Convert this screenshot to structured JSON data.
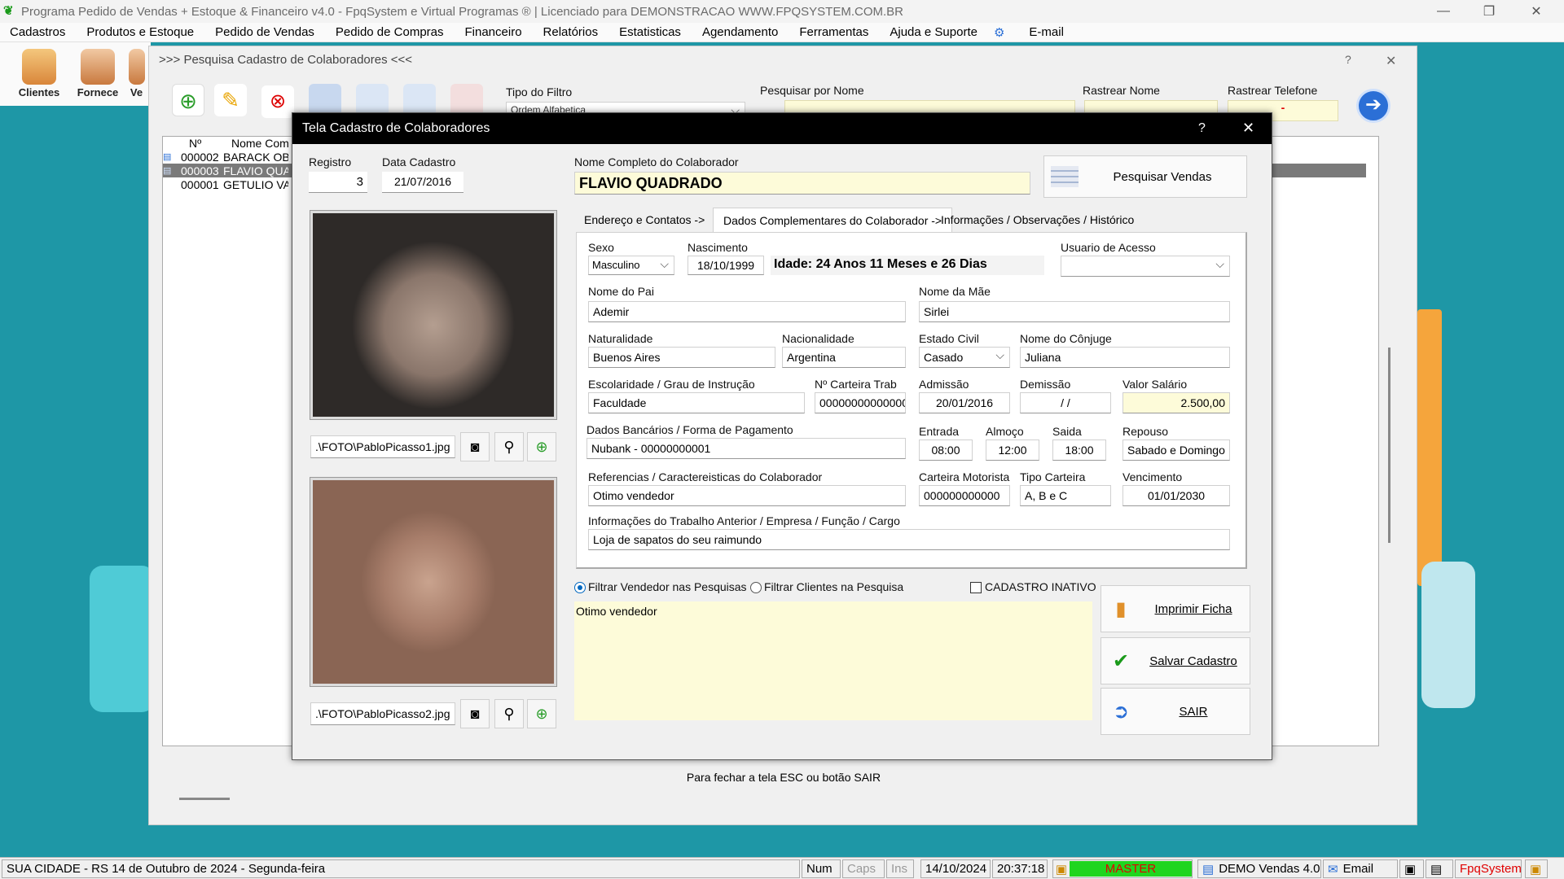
{
  "app": {
    "title": "Programa Pedido de Vendas + Estoque & Financeiro v4.0 - FpqSystem e Virtual Programas ® | Licenciado para  DEMONSTRACAO WWW.FPQSYSTEM.COM.BR"
  },
  "menu": {
    "items": [
      "Cadastros",
      "Produtos e Estoque",
      "Pedido de Vendas",
      "Pedido de Compras",
      "Financeiro",
      "Relatórios",
      "Estatisticas",
      "Agendamento",
      "Ferramentas",
      "Ajuda e Suporte",
      "E-mail"
    ]
  },
  "toolbar": {
    "clientes": "Clientes",
    "fornece": "Fornece",
    "ve": "Ve"
  },
  "search_window": {
    "title": ">>> Pesquisa Cadastro de Colaboradores <<<",
    "filter_type_label": "Tipo do Filtro",
    "filter_type_value": "Ordem Alfabetica",
    "search_name_label": "Pesquisar por Nome",
    "track_name_label": "Rastrear Nome",
    "track_phone_label": "Rastrear Telefone",
    "track_phone_value": "-",
    "columns": [
      "Nº",
      "Nome Comp"
    ],
    "rows": [
      {
        "num": "000002",
        "name": "BARACK OB"
      },
      {
        "num": "000003",
        "name": "FLAVIO QUA"
      },
      {
        "num": "000001",
        "name": "GETULIO VA"
      }
    ],
    "footer_hint": "Para fechar a tela ESC ou botão SAIR"
  },
  "dialog": {
    "title": "Tela Cadastro de Colaboradores",
    "help": "?",
    "registro_label": "Registro",
    "registro": "3",
    "data_cadastro_label": "Data Cadastro",
    "data_cadastro": "21/07/2016",
    "nome_label": "Nome Completo do Colaborador",
    "nome": "FLAVIO QUADRADO",
    "pesquisar_vendas": "Pesquisar Vendas",
    "foto1_path": ".\\FOTO\\PabloPicasso1.jpg",
    "foto2_path": ".\\FOTO\\PabloPicasso2.jpg",
    "tabs": [
      "Endereço e Contatos ->",
      "Dados Complementares do Colaborador ->",
      "Informações / Observações / Histórico"
    ],
    "sexo_label": "Sexo",
    "sexo": "Masculino",
    "nascimento_label": "Nascimento",
    "nascimento": "18/10/1999",
    "idade": "Idade: 24 Anos 11 Meses e 26 Dias",
    "usuario_label": "Usuario de Acesso",
    "usuario": "",
    "pai_label": "Nome do Pai",
    "pai": "Ademir",
    "mae_label": "Nome da Mãe",
    "mae": "Sirlei",
    "naturalidade_label": "Naturalidade",
    "naturalidade": "Buenos Aires",
    "nacionalidade_label": "Nacionalidade",
    "nacionalidade": "Argentina",
    "estado_civil_label": "Estado Civil",
    "estado_civil": "Casado",
    "conjuge_label": "Nome do Cônjuge",
    "conjuge": "Juliana",
    "escolaridade_label": "Escolaridade / Grau de Instrução",
    "escolaridade": "Faculdade",
    "carteira_trab_label": "Nº Carteira Trab",
    "carteira_trab": "00000000000000",
    "admissao_label": "Admissão",
    "admissao": "20/01/2016",
    "demissao_label": "Demissão",
    "demissao": "/ /",
    "salario_label": "Valor Salário",
    "salario": "2.500,00",
    "bancarios_label": "Dados Bancários / Forma de Pagamento",
    "bancarios": "Nubank - 00000000001",
    "entrada_label": "Entrada",
    "entrada": "08:00",
    "almoco_label": "Almoço",
    "almoco": "12:00",
    "saida_label": "Saida",
    "saida": "18:00",
    "repouso_label": "Repouso",
    "repouso": "Sabado e Domingo",
    "referencias_label": "Referencias / Caractereisticas do Colaborador",
    "referencias": "Otimo vendedor",
    "motorista_label": "Carteira Motorista",
    "motorista": "000000000000",
    "tipo_carteira_label": "Tipo Carteira",
    "tipo_carteira": "A, B e C",
    "vencimento_label": "Vencimento",
    "vencimento": "01/01/2030",
    "trabalho_anterior_label": "Informações do Trabalho Anterior / Empresa / Função / Cargo",
    "trabalho_anterior": "Loja de sapatos do seu raimundo",
    "radio_vendedor": "Filtrar Vendedor nas Pesquisas",
    "radio_clientes": "Filtrar Clientes na Pesquisa",
    "inativo": "CADASTRO INATIVO",
    "obs": "Otimo vendedor",
    "btn_imprimir": "Imprimir Ficha",
    "btn_salvar": "Salvar Cadastro",
    "btn_sair": "SAIR"
  },
  "statusbar": {
    "city": "SUA CIDADE - RS 14 de Outubro de 2024 - Segunda-feira",
    "num": "Num",
    "caps": "Caps",
    "ins": "Ins",
    "date": "14/10/2024",
    "time": "20:37:18",
    "master": "MASTER",
    "demo": "DEMO Vendas 4.0",
    "email": "Email",
    "brand": "FpqSystem"
  },
  "colors": {
    "accent_red": "#e00000",
    "master_green": "#1fd51f",
    "yellow_field": "#fdfbd9"
  }
}
